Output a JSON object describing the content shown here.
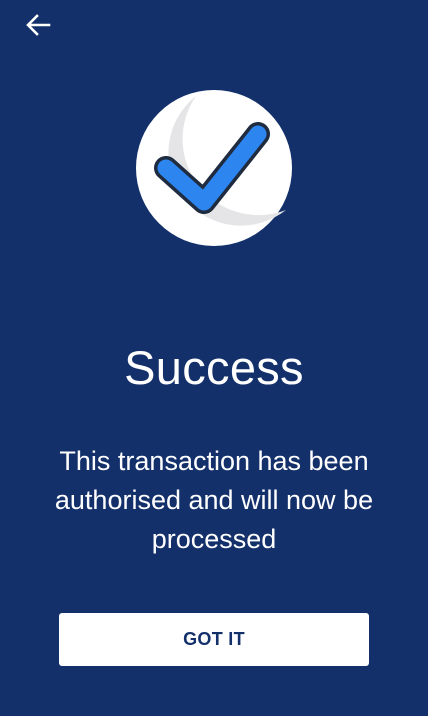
{
  "header": {
    "back_icon": "arrow-left-icon"
  },
  "status": {
    "icon": "checkmark-icon",
    "title": "Success",
    "message": "This transaction has been authorised and will now be processed"
  },
  "actions": {
    "confirm_label": "GOT IT"
  },
  "colors": {
    "background": "#13306b",
    "check_blue": "#2d86f0",
    "circle": "#ffffff",
    "circle_shadow": "#e5e5e7"
  }
}
